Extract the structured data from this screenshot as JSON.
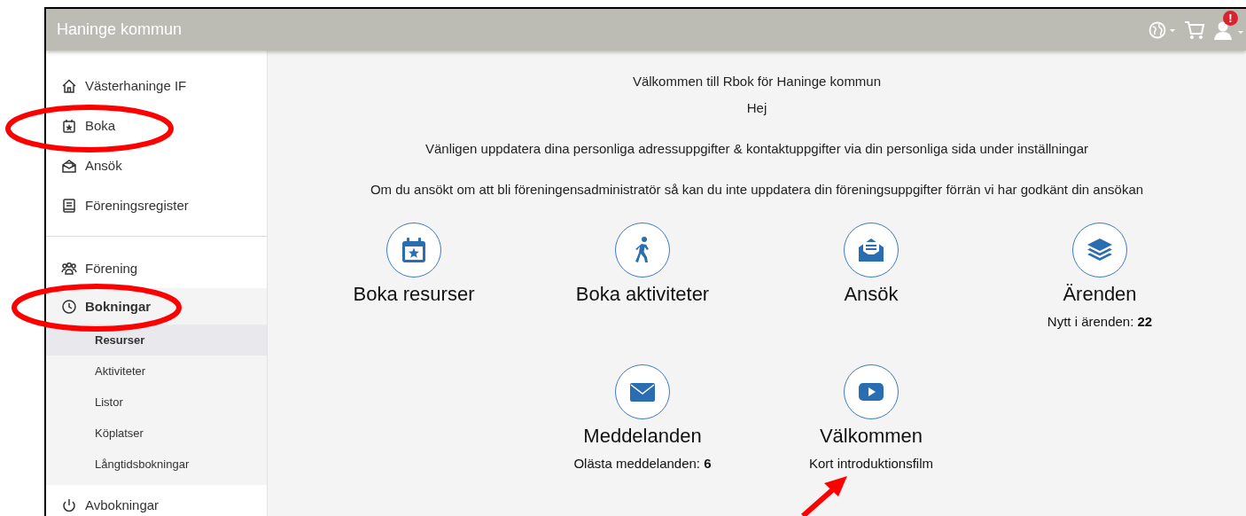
{
  "header": {
    "title": "Haninge kommun",
    "alert_badge": "!"
  },
  "sidebar": {
    "groups": [
      {
        "items": [
          {
            "label": "Västerhaninge IF",
            "expanded": false
          },
          {
            "label": "Boka",
            "expanded": false
          },
          {
            "label": "Ansök",
            "expanded": false
          },
          {
            "label": "Föreningsregister",
            "expanded": false
          }
        ]
      },
      {
        "items": [
          {
            "label": "Förening",
            "expanded": false
          },
          {
            "label": "Bokningar",
            "expanded": true,
            "children": [
              {
                "label": "Resurser",
                "selected": true
              },
              {
                "label": "Aktiviteter",
                "selected": false
              },
              {
                "label": "Listor",
                "selected": false
              },
              {
                "label": "Köplatser",
                "selected": false
              },
              {
                "label": "Långtidsbokningar",
                "selected": false
              }
            ]
          },
          {
            "label": "Avbokningar",
            "expanded": false
          }
        ]
      }
    ]
  },
  "welcome": [
    "Välkommen till Rbok för Haninge kommun",
    "Hej",
    "Vänligen uppdatera dina personliga adressuppgifter & kontaktuppgifter via din personliga sida under inställningar",
    "Om du ansökt om att bli föreningensadministratör så kan du inte uppdatera din föreningsuppgifter förrän vi har godkänt din ansökan"
  ],
  "tiles": [
    {
      "title": "Boka resurser"
    },
    {
      "title": "Boka aktiviteter"
    },
    {
      "title": "Ansök"
    },
    {
      "title": "Ärenden",
      "subtitle": "Nytt i ärenden: **22**"
    },
    {
      "title": "Meddelanden",
      "subtitle": "Olästa meddelanden: **6**"
    },
    {
      "title": "Välkommen",
      "subtitle": "Kort introduktionsfilm"
    }
  ]
}
